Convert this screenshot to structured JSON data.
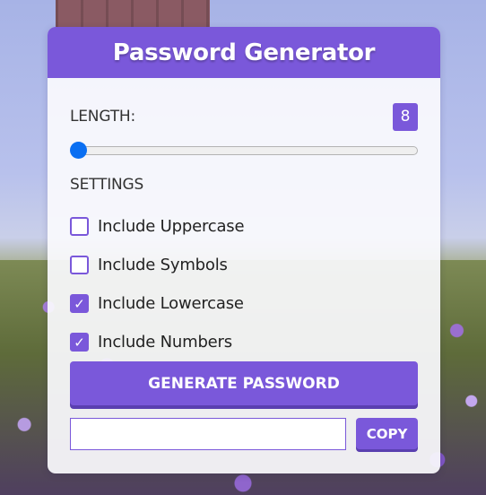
{
  "app": {
    "title": "Password Generator"
  },
  "length": {
    "label": "LENGTH:",
    "value": "8",
    "slider_fraction": 0.0
  },
  "settings": {
    "label": "SETTINGS",
    "options": [
      {
        "label": "Include Uppercase",
        "checked": false
      },
      {
        "label": "Include Symbols",
        "checked": false
      },
      {
        "label": "Include Lowercase",
        "checked": true
      },
      {
        "label": "Include Numbers",
        "checked": true
      }
    ]
  },
  "actions": {
    "generate_label": "GENERATE PASSWORD",
    "copy_label": "COPY"
  },
  "output": {
    "value": ""
  },
  "colors": {
    "accent": "#7a58da",
    "slider_thumb": "#0a6ff2"
  },
  "icons": {
    "check": "check-icon"
  }
}
